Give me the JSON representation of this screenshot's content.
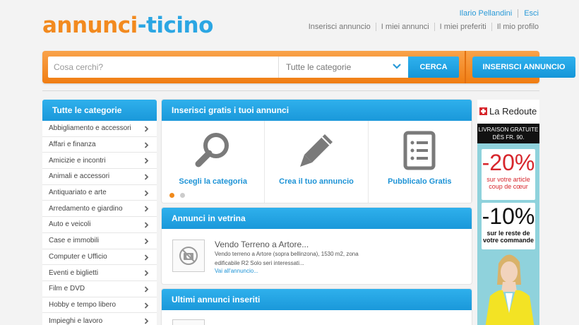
{
  "logo": {
    "part1": "annunci",
    "part2": "-ticino"
  },
  "user": {
    "name": "Ilario Pellandini",
    "logout": "Esci"
  },
  "nav": [
    "Inserisci annuncio",
    "I miei annunci",
    "I miei preferiti",
    "Il mio profilo"
  ],
  "search": {
    "placeholder": "Cosa cerchi?",
    "category": "Tutte le categorie",
    "button": "CERCA",
    "insert_button": "INSERISCI ANNUNCIO"
  },
  "sidebar": {
    "title": "Tutte le categorie",
    "items": [
      "Abbigliamento e accessori",
      "Affari e finanza",
      "Amicizie e incontri",
      "Animali e accessori",
      "Antiquariato e arte",
      "Arredamento e giardino",
      "Auto e veicoli",
      "Case e immobili",
      "Computer e Ufficio",
      "Eventi e biglietti",
      "Film e DVD",
      "Hobby e tempo libero",
      "Impieghi e lavoro"
    ]
  },
  "steps_panel": {
    "title": "Inserisci gratis i tuoi annunci",
    "steps": [
      "Scegli la categoria",
      "Crea il tuo annuncio",
      "Pubblicalo Gratis"
    ]
  },
  "featured": {
    "title": "Annunci in vetrina",
    "ad_title": "Vendo Terreno a Artore...",
    "ad_desc": "Vendo terreno a Artore (sopra bellinzona), 1530 m2, zona edificabile R2 Solo seri interessati...",
    "ad_link": "Vai all'annuncio..."
  },
  "latest": {
    "title": "Ultimi annunci inseriti"
  },
  "banner": {
    "brand": "La Redoute",
    "shipping": "LIVRAISON GRATUITE DÈS FR. 90.",
    "offer1_pct": "-20%",
    "offer1_text": "sur votre article coup de cœur",
    "offer2_pct": "-10%",
    "offer2_text": "sur le reste de votre commande"
  },
  "colors": {
    "orange": "#f28a1f",
    "blue": "#1d93d6"
  }
}
